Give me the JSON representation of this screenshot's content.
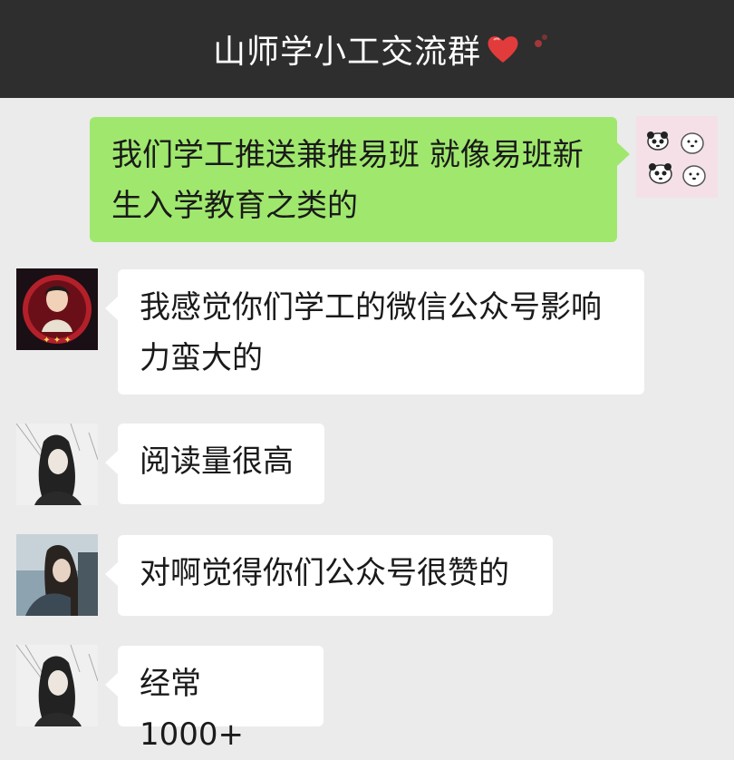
{
  "header": {
    "title": "山师学小工交流群",
    "heart_icon": "heart-icon",
    "heart_color": "#e23b3b"
  },
  "messages": [
    {
      "side": "right",
      "text": "我们学工推送兼推易班 就像易班新生入学教育之类的",
      "avatar_icon": "panda-bears-avatar"
    },
    {
      "side": "left",
      "text": "我感觉你们学工的微信公众号影响力蛮大的",
      "avatar_icon": "red-portrait-avatar"
    },
    {
      "side": "left",
      "text": "阅读量很高",
      "avatar_icon": "girl-sketch-avatar"
    },
    {
      "side": "left",
      "text": "对啊觉得你们公众号很赞的",
      "avatar_icon": "girl-photo-avatar"
    },
    {
      "side": "left",
      "text": "经常 1000+",
      "avatar_icon": "girl-sketch-avatar"
    }
  ],
  "colors": {
    "header_bg": "#2e2e2e",
    "chat_bg": "#ebebeb",
    "my_bubble": "#9fe86d",
    "other_bubble": "#ffffff"
  }
}
